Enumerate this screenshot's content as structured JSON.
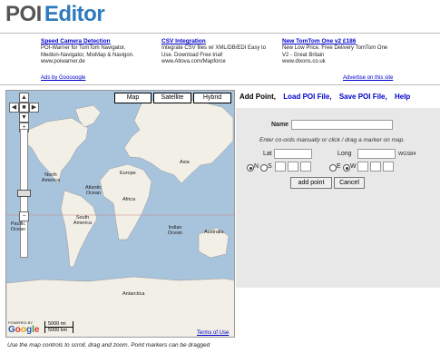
{
  "header": {
    "logo_part1": "POI",
    "logo_part2": "Editor"
  },
  "ads": [
    {
      "title": "Speed Camera Detection",
      "line1": "POI-Warner for TomTom Navigator,",
      "line2": "Medion-Navigator, MioMap & Navigon.",
      "line3": "www.poiwarner.de"
    },
    {
      "title": "CSV Integration",
      "line1": "Integrate CSV files w/ XML/DB/EDI Easy to",
      "line2": "Use. Download Free trial!",
      "line3": "www.Altova.com/Mapforce"
    },
    {
      "title": "New TomTom One v2 £186",
      "line1": "New Low Price. Free Delivery TomTom One",
      "line2": "V2 - Great Britain",
      "line3": "www.dixons.co.uk"
    }
  ],
  "ads_by": "Ads by Gooooogle",
  "advertise": "Advertise on this site",
  "map": {
    "types": [
      "Map",
      "Satellite",
      "Hybrid"
    ],
    "labels": {
      "north_america": "North America",
      "europe": "Europe",
      "asia": "Asia",
      "atlantic": "Atlantic Ocean",
      "africa": "Africa",
      "pacific": "Pacific Ocean",
      "south_america": "South America",
      "indian": "Indian Ocean",
      "australia": "Australia",
      "antarctica": "Antarctica"
    },
    "powered": "POWERED BY",
    "google": "Google",
    "scale_mi": "5000 mi",
    "scale_km": "5000 km",
    "terms": "Terms of Use",
    "hint": "Use the map controls to scroll, drag and zoom. Point markers can be dragged"
  },
  "panel": {
    "links": [
      "Add Point,",
      "Load POI File,",
      "Save POI File,",
      "Help"
    ],
    "name_label": "Name",
    "instructions": "Enter co-ords manually or click / drag a marker on map.",
    "lat_label": "Lat",
    "long_label": "Long",
    "datum": "WGS84",
    "ns": [
      "N",
      "S"
    ],
    "ew": [
      "E",
      "W"
    ],
    "add_button": "add point",
    "cancel_button": "Cancel"
  }
}
